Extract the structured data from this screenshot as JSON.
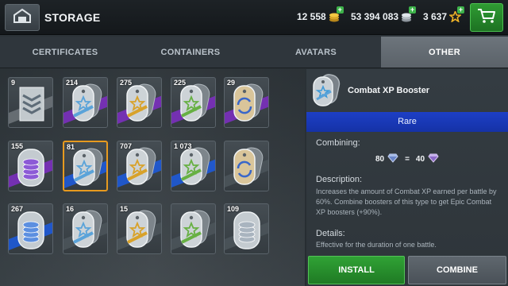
{
  "header": {
    "title": "STORAGE",
    "credits": "12 558",
    "silver": "53 394 083",
    "xp": "3 637"
  },
  "tabs": [
    {
      "label": "CERTIFICATES",
      "active": false
    },
    {
      "label": "CONTAINERS",
      "active": false
    },
    {
      "label": "AVATARS",
      "active": false
    },
    {
      "label": "OTHER",
      "active": true
    }
  ],
  "items": [
    {
      "count": "9",
      "icon": "rank-chevron-certificate-icon",
      "stripe": "#6b7278",
      "tint": "#6b7278"
    },
    {
      "count": "214",
      "icon": "booster-star-blue-icon",
      "stripe": "#7b2fbe",
      "tint": "#5aa3d9"
    },
    {
      "count": "275",
      "icon": "booster-star-gold-icon",
      "stripe": "#7b2fbe",
      "tint": "#d8a22a"
    },
    {
      "count": "225",
      "icon": "booster-star-green-icon",
      "stripe": "#7b2fbe",
      "tint": "#67b043"
    },
    {
      "count": "29",
      "icon": "booster-refresh-icon",
      "stripe": "#7b2fbe",
      "tint": "#8a6a2b"
    },
    {
      "count": "155",
      "icon": "silver-coins-booster-icon",
      "stripe": "#7b2fbe",
      "tint": "#8c5ad6"
    },
    {
      "count": "81",
      "icon": "booster-star-blue-icon",
      "stripe": "#1e5ad8",
      "tint": "#5aa3d9"
    },
    {
      "count": "707",
      "icon": "booster-star-gold-icon",
      "stripe": "#1e5ad8",
      "tint": "#d8a22a"
    },
    {
      "count": "1 073",
      "icon": "booster-star-green-icon",
      "stripe": "#1e5ad8",
      "tint": "#67b043"
    },
    {
      "count": "",
      "icon": "booster-refresh-icon",
      "stripe": "#4b545a",
      "tint": "#8a6a2b"
    },
    {
      "count": "267",
      "icon": "silver-coins-booster-icon",
      "stripe": "#1e5ad8",
      "tint": "#5c8fe0"
    },
    {
      "count": "16",
      "icon": "booster-star-blue-icon",
      "stripe": "#4b545a",
      "tint": "#5aa3d9"
    },
    {
      "count": "15",
      "icon": "booster-star-gold-icon",
      "stripe": "#4b545a",
      "tint": "#d8a22a"
    },
    {
      "count": "",
      "icon": "booster-star-green-icon",
      "stripe": "#4b545a",
      "tint": "#67b043"
    },
    {
      "count": "109",
      "icon": "silver-coins-booster-icon",
      "stripe": "#4b545a",
      "tint": "#a9b4bf"
    }
  ],
  "selected_index": 6,
  "detail": {
    "title": "Combat XP Booster",
    "rarity": "Rare",
    "combining_label": "Combining:",
    "combine_from": "80",
    "equals": "=",
    "combine_to": "40",
    "description_label": "Description:",
    "description": "Increases the amount of Combat XP earned per battle by 60%. Combine boosters of this type to get Epic Combat XP boosters (+90%).",
    "details_label": "Details:",
    "details_text": "Effective for the duration of one battle.",
    "install_label": "INSTALL",
    "combine_label": "COMBINE"
  },
  "colors": {
    "rarity_blue": "#1d3fc6",
    "install_green": "#2f9b33",
    "selected_orange": "#e79a1f"
  }
}
